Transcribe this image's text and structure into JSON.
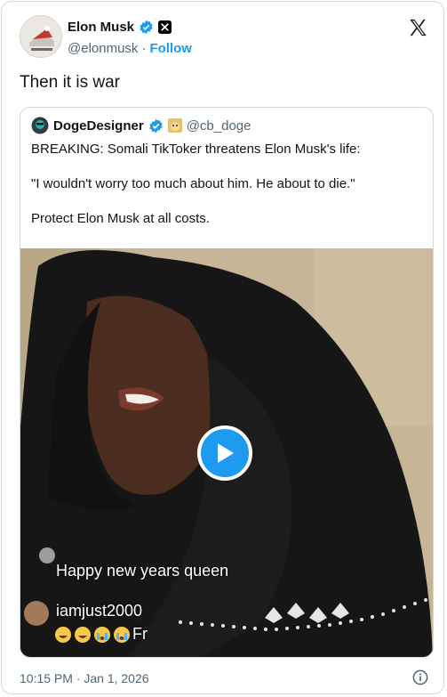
{
  "author": {
    "name": "Elon Musk",
    "handle": "@elonmusk",
    "separator": "·",
    "follow_label": "Follow",
    "verified_color": "#1d9bf0"
  },
  "tweet": {
    "text": "Then it is war",
    "timestamp": "10:15 PM · Jan 1, 2026"
  },
  "quoted": {
    "name": "DogeDesigner",
    "handle": "@cb_doge",
    "lines": [
      "BREAKING: Somali TikToker threatens Elon Musk's life:",
      "\"I wouldn't worry too much about him. He about to die.\"",
      "Protect Elon Musk at all costs."
    ],
    "video": {
      "overlay_comment_1": "Happy new years queen",
      "overlay_user": "iamjust2000",
      "overlay_comment_2": "Fr"
    }
  },
  "icons": {
    "verified": "verified-badge-icon",
    "x_logo": "x-logo-icon",
    "play": "play-icon",
    "info": "info-icon"
  }
}
